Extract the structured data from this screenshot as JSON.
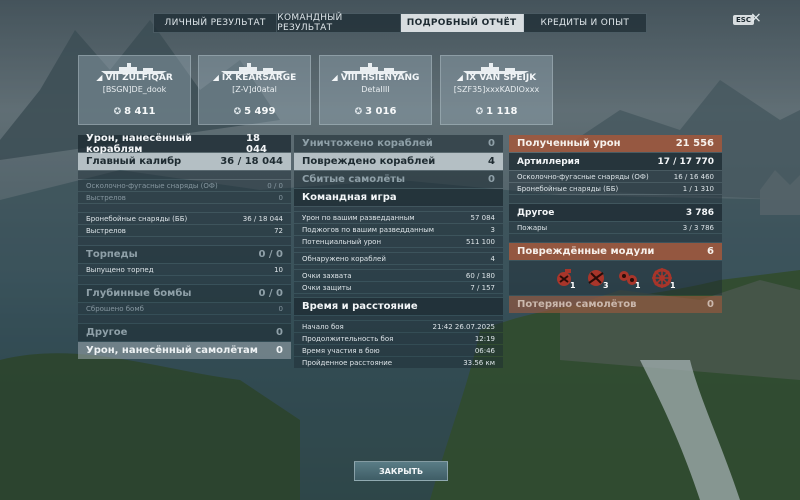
{
  "tabs": [
    "ЛИЧНЫЙ РЕЗУЛЬТАТ",
    "КОМАНДНЫЙ РЕЗУЛЬТАТ",
    "ПОДРОБНЫЙ ОТЧЁТ",
    "КРЕДИТЫ И ОПЫТ"
  ],
  "active_tab": "ПОДРОБНЫЙ ОТЧЁТ",
  "esc_label": "ESC",
  "players": [
    {
      "ship": "VII ZULFIQAR",
      "player": "[BSGN]DE_dook",
      "xp": "8 411"
    },
    {
      "ship": "IX KEARSARGE",
      "player": "[Z-V]d0atal",
      "xp": "5 499"
    },
    {
      "ship": "VIII HSIENYANG",
      "player": "DetaIIII",
      "xp": "3 016"
    },
    {
      "ship": "IX VAN SPEIJK",
      "player": "[SZF35]xxxKADIOxxx",
      "xp": "1 118"
    }
  ],
  "left": {
    "damage_title": "Урон, нанесённый кораблям",
    "damage_total": "18 044",
    "main_battery": "Главный калибр",
    "main_battery_val": "36 / 18 044",
    "he_shells": "Осколочно-фугасные снаряды (ОФ)",
    "he_val": "0 / 0",
    "he_shots": "Выстрелов",
    "he_shots_val": "0",
    "ap_shells": "Бронебойные снаряды (ББ)",
    "ap_val": "36 / 18 044",
    "ap_shots": "Выстрелов",
    "ap_shots_val": "72",
    "torpedoes": "Торпеды",
    "torpedoes_val": "0 / 0",
    "torp_fired": "Выпущено торпед",
    "torp_fired_val": "10",
    "depth": "Глубинные бомбы",
    "depth_val": "0 / 0",
    "depth_dropped": "Сброшено бомб",
    "depth_dropped_val": "0",
    "other": "Другое",
    "other_val": "0",
    "aircraft_damage": "Урон, нанесённый самолётам",
    "aircraft_damage_val": "0"
  },
  "middle": {
    "destroyed": "Уничтожено кораблей",
    "destroyed_val": "0",
    "damaged": "Повреждено кораблей",
    "damaged_val": "4",
    "planes": "Сбитые самолёты",
    "planes_val": "0",
    "team_title": "Командная игра",
    "spot_damage": "Урон по вашим разведданным",
    "spot_damage_val": "57 084",
    "spot_fires": "Поджогов по вашим разведданным",
    "spot_fires_val": "3",
    "potential": "Потенциальный урон",
    "potential_val": "511 100",
    "spotted": "Обнаружено кораблей",
    "spotted_val": "4",
    "capture": "Очки захвата",
    "capture_val": "60 / 180",
    "defense": "Очки защиты",
    "defense_val": "7 / 157",
    "time_title": "Время и расстояние",
    "start": "Начало боя",
    "start_val": "21:42  26.07.2025",
    "duration": "Продолжительность боя",
    "duration_val": "12:19",
    "participation": "Время участия в бою",
    "participation_val": "06:46",
    "distance": "Пройденное расстояние",
    "distance_val": "33.56 км"
  },
  "right": {
    "received": "Полученный урон",
    "received_val": "21 556",
    "artillery": "Артиллерия",
    "artillery_val": "17 / 17 770",
    "he": "Осколочно-фугасные снаряды (ОФ)",
    "he_val": "16 / 16 460",
    "ap": "Бронебойные снаряды (ББ)",
    "ap_val": "1 / 1 310",
    "other": "Другое",
    "other_val": "3 786",
    "fires": "Пожары",
    "fires_val": "3 / 3 786",
    "modules": "Повреждённые модули",
    "modules_val": "6",
    "module_items": [
      {
        "icon": "engine-module-icon",
        "count": "1"
      },
      {
        "icon": "gun-module-icon",
        "count": "3"
      },
      {
        "icon": "torpedo-module-icon",
        "count": "1"
      },
      {
        "icon": "steering-module-icon",
        "count": "1"
      }
    ],
    "planes_lost": "Потеряно самолётов",
    "planes_lost_val": "0"
  },
  "close_button": "ЗАКРЫТЬ"
}
